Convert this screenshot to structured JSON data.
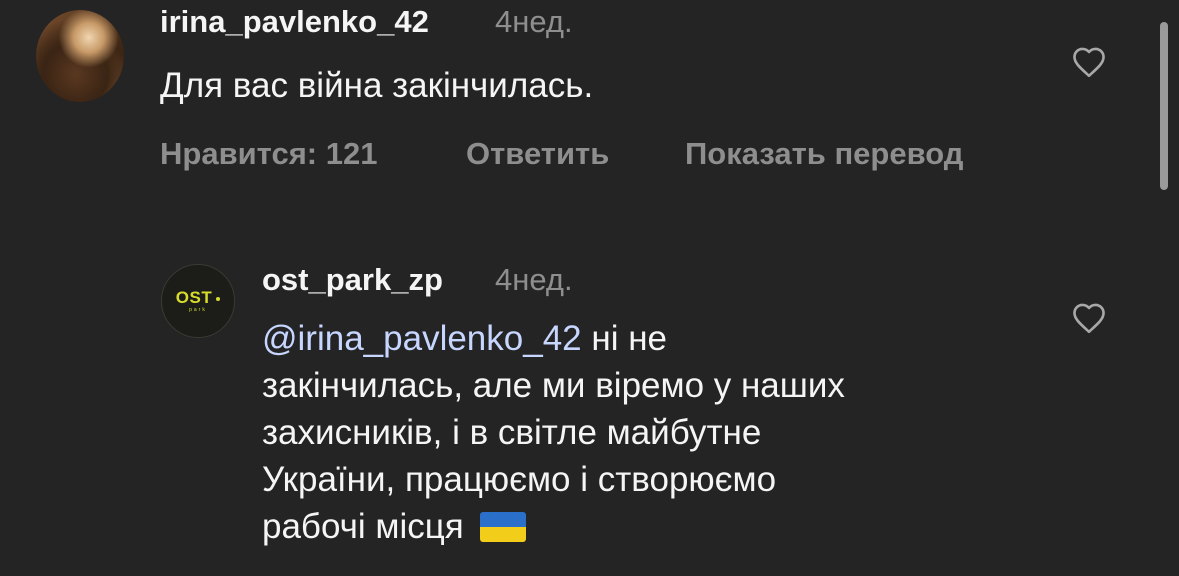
{
  "comments": [
    {
      "username": "irina_pavlenko_42",
      "time": "4нед.",
      "text": "Для вас війна закінчилась.",
      "likes_label": "Нравится: 121",
      "reply_label": "Ответить",
      "translate_label": "Показать перевод"
    },
    {
      "username": "ost_park_zp",
      "time": "4нед.",
      "mention": "@irina_pavlenko_42",
      "line1_rest": " ні не",
      "line2": "закінчилась, але ми віремо у наших",
      "line3": "захисників, і в світле майбутне",
      "line4": "України, працюємо і створюємо",
      "line5": "рабочі місця",
      "emoji": "ukraine-flag"
    }
  ],
  "logo": {
    "main": "OST",
    "sub": "park"
  },
  "colors": {
    "background": "#242424",
    "text": "#f5f5f5",
    "muted": "#8e8e8e",
    "mention": "#c7d6ff",
    "logo": "#d8dd2c"
  }
}
